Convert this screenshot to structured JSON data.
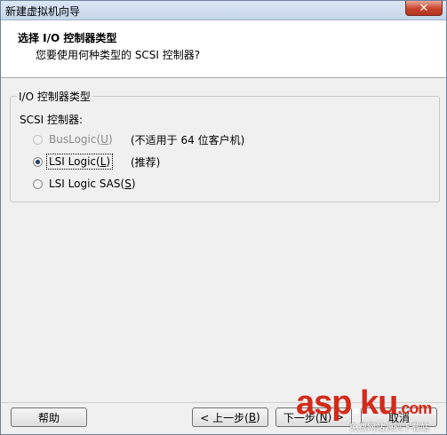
{
  "window": {
    "title": "新建虚拟机向导",
    "close_glyph": "✕"
  },
  "header": {
    "title": "选择 I/O 控制器类型",
    "subtitle": "您要使用何种类型的 SCSI 控制器?"
  },
  "group": {
    "legend": "I/O 控制器类型",
    "scsi_label": "SCSI 控制器:",
    "options": [
      {
        "label": "BusLogic(",
        "accel": "U",
        "tail": ")",
        "note": "(不适用于 64 位客户机)",
        "state": "disabled"
      },
      {
        "label": "LSI Logic(",
        "accel": "L",
        "tail": ")",
        "note": "(推荐)",
        "state": "checked"
      },
      {
        "label": "LSI Logic SAS(",
        "accel": "S",
        "tail": ")",
        "note": "",
        "state": "unchecked"
      }
    ]
  },
  "buttons": {
    "help": "帮助",
    "back_prefix": "< 上一步(",
    "back_accel": "B",
    "back_tail": ")",
    "next_prefix": "下一步(",
    "next_accel": "N",
    "next_tail": ") >",
    "cancel": "取消"
  },
  "watermark": {
    "text_main": "asp",
    "text_dot": ".",
    "text_end": "ku",
    "text_com": ".com",
    "sub": "免费网站源码下载站"
  }
}
